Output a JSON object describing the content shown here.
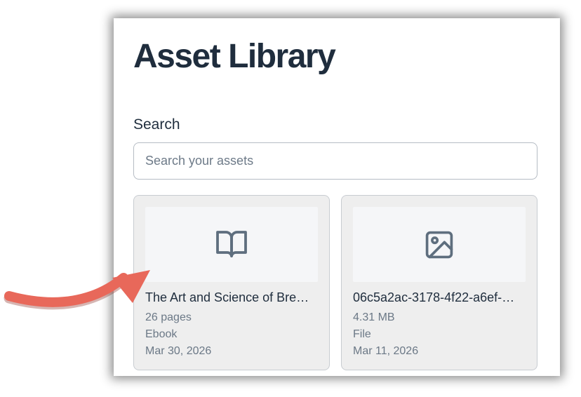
{
  "page": {
    "title": "Asset Library"
  },
  "search": {
    "label": "Search",
    "placeholder": "Search your assets",
    "value": ""
  },
  "assets": [
    {
      "title": "The Art and Science of Bre…",
      "meta1": "26 pages",
      "meta2": "Ebook",
      "meta3": "Mar 30, 2026",
      "icon": "book-open-icon"
    },
    {
      "title": "06c5a2ac-3178-4f22-a6ef-…",
      "meta1": "4.31 MB",
      "meta2": "File",
      "meta3": "Mar 11, 2026",
      "icon": "image-icon"
    }
  ],
  "annotation": {
    "icon": "pointer-arrow-icon",
    "color": "#e8685a"
  },
  "colors": {
    "text": "#1f2d3d",
    "muted": "#6b7886",
    "icon": "#5e6e7e"
  }
}
